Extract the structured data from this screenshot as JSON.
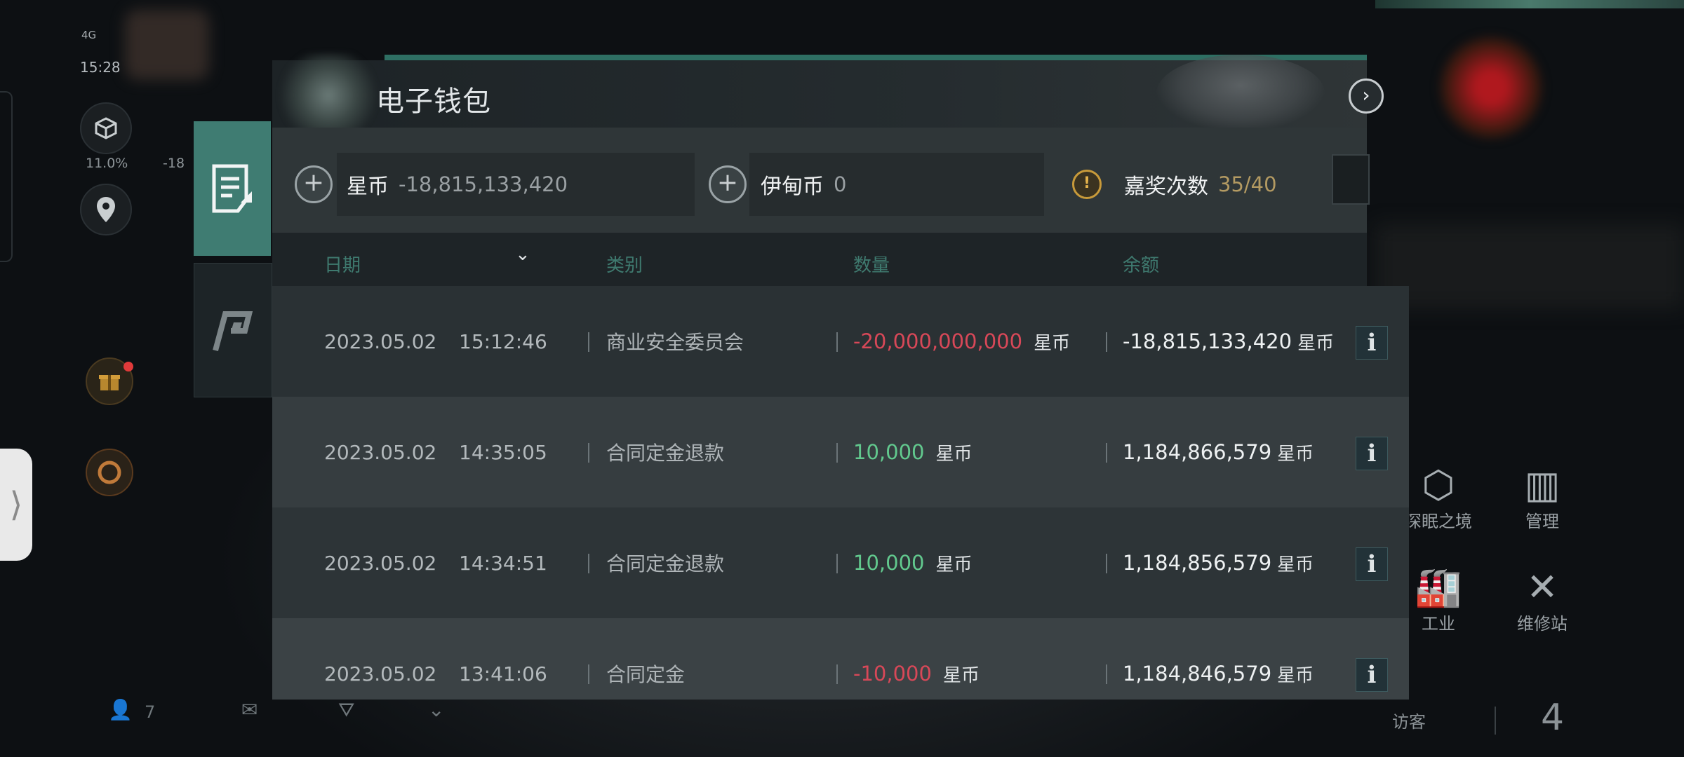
{
  "status": {
    "network": "4G",
    "time": "15:28"
  },
  "left_hud": {
    "percent": "11.0%",
    "secondary": "-18"
  },
  "wallet": {
    "title": "电子钱包",
    "currencies": {
      "star_coin": {
        "name": "星币",
        "value": "-18,815,133,420"
      },
      "eden_coin": {
        "name": "伊甸币",
        "value": "0"
      },
      "prize": {
        "name": "嘉奖次数",
        "value": "35/40"
      }
    },
    "columns": {
      "date": "日期",
      "category": "类别",
      "amount": "数量",
      "balance": "余额"
    },
    "unit": "星币",
    "rows": [
      {
        "date": "2023.05.02",
        "time": "15:12:46",
        "category": "商业安全委员会",
        "amount": "-20,000,000,000",
        "amount_sign": "negative",
        "balance": "-18,815,133,420"
      },
      {
        "date": "2023.05.02",
        "time": "14:35:05",
        "category": "合同定金退款",
        "amount": "10,000",
        "amount_sign": "positive",
        "balance": "1,184,866,579"
      },
      {
        "date": "2023.05.02",
        "time": "14:34:51",
        "category": "合同定金退款",
        "amount": "10,000",
        "amount_sign": "positive",
        "balance": "1,184,856,579"
      },
      {
        "date": "2023.05.02",
        "time": "13:41:06",
        "category": "合同定金",
        "amount": "-10,000",
        "amount_sign": "negative",
        "balance": "1,184,846,579"
      }
    ]
  },
  "right_hud": {
    "item1": "深眠之境",
    "item2": "管理",
    "item3": "工业",
    "item4": "维修站",
    "visitor_label": "访客",
    "visitor_count": "4"
  },
  "bottom_bar": {
    "members": "7"
  },
  "colors": {
    "accent": "#3f7c72",
    "negative": "#d84858",
    "positive": "#62c98e",
    "warning": "#c89a3a"
  }
}
